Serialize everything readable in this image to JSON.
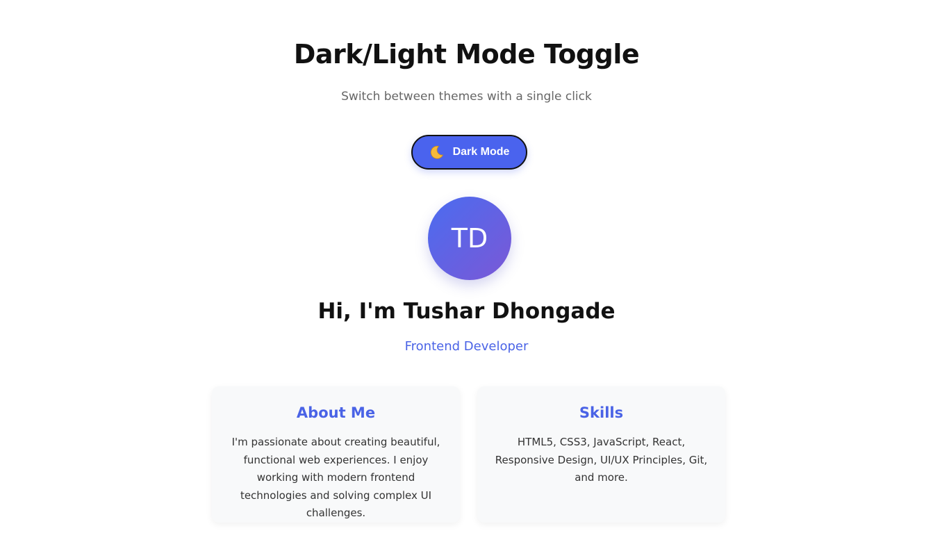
{
  "header": {
    "title": "Dark/Light Mode Toggle",
    "subtitle": "Switch between themes with a single click"
  },
  "toggle": {
    "label": "Dark Mode",
    "icon": "moon-icon",
    "background": "#4a63ee"
  },
  "profile": {
    "initials": "TD",
    "name": "Hi, I'm Tushar Dhongade",
    "role": "Frontend Developer"
  },
  "cards": [
    {
      "title": "About Me",
      "text": "I'm passionate about creating beautiful, functional web experiences. I enjoy working with modern frontend technologies and solving complex UI challenges."
    },
    {
      "title": "Skills",
      "text": "HTML5, CSS3, JavaScript, React, Responsive Design, UI/UX Principles, Git, and more."
    }
  ],
  "colors": {
    "accent": "#4a63e6",
    "avatar_gradient_start": "#4a6cf0",
    "avatar_gradient_end": "#7b58d6",
    "card_background": "#f8f9fa"
  }
}
